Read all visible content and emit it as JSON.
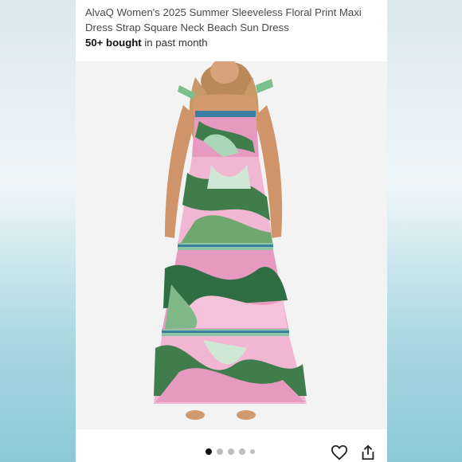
{
  "product": {
    "title": "AlvaQ Women's 2025 Summer Sleeveless Floral Print Maxi Dress Strap Square Neck Beach Sun Dress",
    "bought_count": "50+ bought",
    "bought_suffix": " in past month"
  },
  "carousel": {
    "dot_count": 5,
    "active_index": 0
  },
  "icons": {
    "favorite": "heart-outline-icon",
    "share": "share-icon"
  },
  "colors": {
    "accent": "#111111",
    "dress_pink": "#e79ac0",
    "dress_green": "#3f7d4c"
  }
}
